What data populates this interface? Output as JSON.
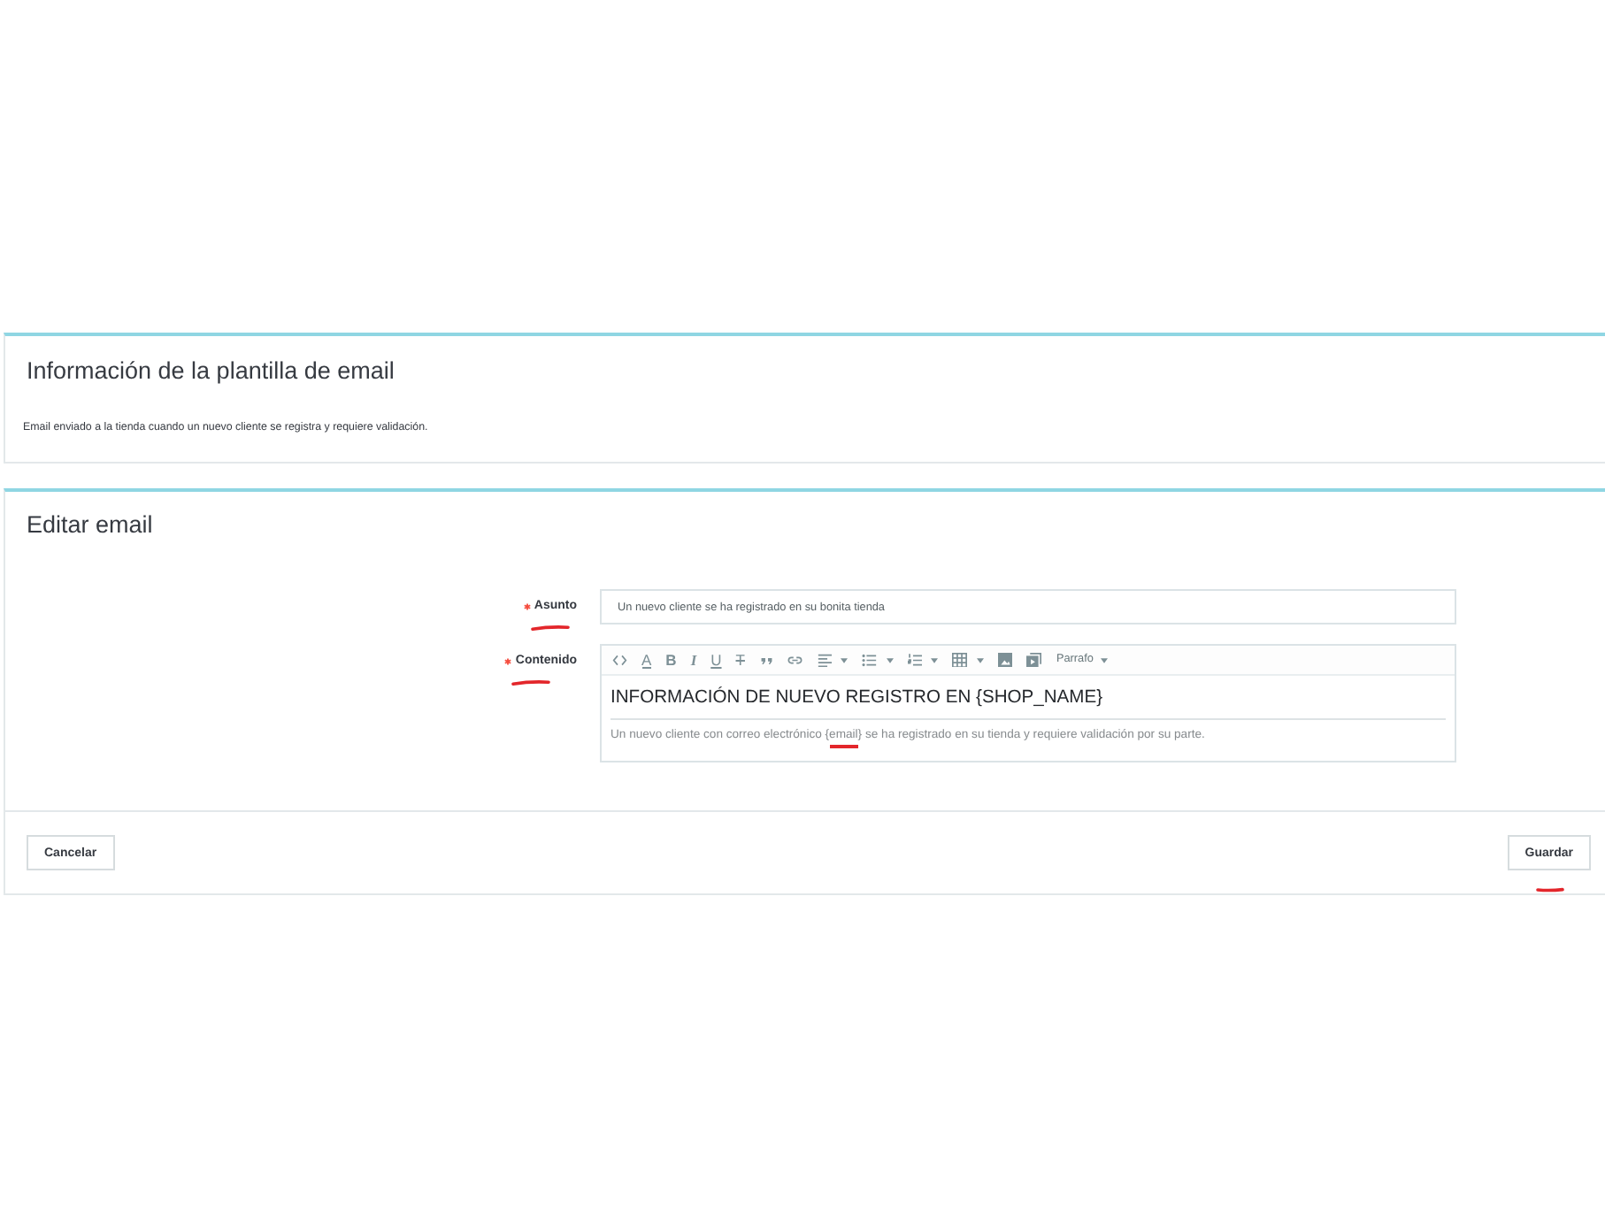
{
  "template_info": {
    "title": "Información de la plantilla de email",
    "description": "Email enviado a la tienda cuando un nuevo cliente se registra y requiere validación."
  },
  "edit_email": {
    "title": "Editar email",
    "fields": [
      {
        "kind": "text",
        "label": "Asunto",
        "required": true,
        "marked": true,
        "value": "Un nuevo cliente se ha registrado en su bonita tienda"
      },
      {
        "kind": "editor",
        "label": "Contenido",
        "required": true,
        "marked": true,
        "toolbar": [
          {
            "kind": "code",
            "dropdown": false
          },
          {
            "kind": "forecolor",
            "glyph": "A",
            "dropdown": false
          },
          {
            "kind": "bold",
            "glyph": "B",
            "dropdown": false
          },
          {
            "kind": "italic",
            "glyph": "I",
            "dropdown": false
          },
          {
            "kind": "underline",
            "glyph": "U",
            "dropdown": false
          },
          {
            "kind": "strikethrough",
            "glyph": "T",
            "dropdown": false
          },
          {
            "kind": "quote",
            "dropdown": false
          },
          {
            "kind": "link",
            "dropdown": false
          },
          {
            "kind": "align",
            "dropdown": true
          },
          {
            "kind": "bullets",
            "dropdown": true
          },
          {
            "kind": "numbers",
            "dropdown": true
          },
          {
            "kind": "table",
            "dropdown": true
          },
          {
            "kind": "image",
            "dropdown": false
          },
          {
            "kind": "media",
            "dropdown": false
          },
          {
            "kind": "format",
            "label": "Parrafo",
            "dropdown": true
          }
        ],
        "heading": "INFORMACIÓN DE NUEVO REGISTRO EN {SHOP_NAME}",
        "body": [
          {
            "text": "Un nuevo cliente con correo electrónico ",
            "marked": false
          },
          {
            "text": "{email}",
            "marked": true
          },
          {
            "text": " se ha registrado en su tienda y requiere validación por su parte.",
            "marked": false
          }
        ]
      }
    ]
  },
  "footer": {
    "buttons": [
      {
        "kind": "cancel",
        "label": "Cancelar",
        "marked": false
      },
      {
        "kind": "save",
        "label": "Guardar",
        "marked": true
      }
    ]
  }
}
